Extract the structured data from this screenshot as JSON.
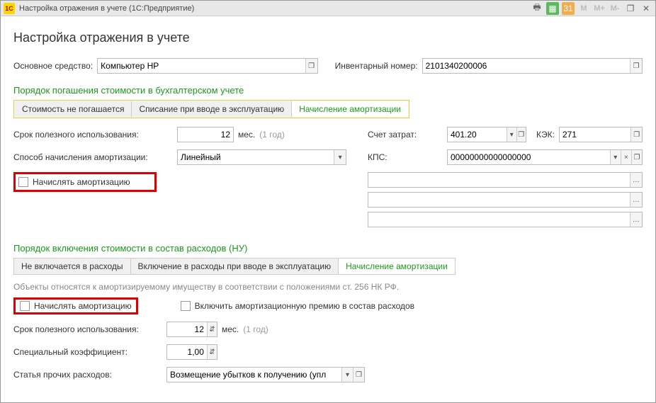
{
  "window": {
    "title": "Настройка отражения в учете  (1С:Предприятие)",
    "m_buttons": [
      "M",
      "M+",
      "M-"
    ]
  },
  "header": "Настройка отражения в учете",
  "top": {
    "asset_label": "Основное средство:",
    "asset_value": "Компьютер HP",
    "inv_label": "Инвентарный номер:",
    "inv_value": "2101340200006"
  },
  "section1": {
    "title": "Порядок погашения стоимости в бухгалтерском учете",
    "tabs": [
      "Стоимость не погашается",
      "Списание при вводе в эксплуатацию",
      "Начисление амортизации"
    ],
    "useful_life_label": "Срок полезного использования:",
    "useful_life_value": "12",
    "useful_life_unit": "мес.",
    "useful_life_hint": "(1 год)",
    "method_label": "Способ начисления амортизации:",
    "method_value": "Линейный",
    "charge_label": "Начислять амортизацию",
    "account_label": "Счет затрат:",
    "account_value": "401.20",
    "kek_label": "КЭК:",
    "kek_value": "271",
    "kps_label": "КПС:",
    "kps_value": "00000000000000000"
  },
  "section2": {
    "title": "Порядок включения стоимости в состав расходов (НУ)",
    "tabs": [
      "Не включается в расходы",
      "Включение в расходы при вводе в эксплуатацию",
      "Начисление амортизации"
    ],
    "note": "Объекты относятся к амортизируемому имуществу в соответствии с положениями ст. 256 НК РФ.",
    "charge_label": "Начислять амортизацию",
    "bonus_label": "Включить амортизационную премию в состав расходов",
    "useful_life_label": "Срок полезного использования:",
    "useful_life_value": "12",
    "useful_life_unit": "мес.",
    "useful_life_hint": "(1 год)",
    "coef_label": "Специальный коэффициент:",
    "coef_value": "1,00",
    "expense_label": "Статья прочих расходов:",
    "expense_value": "Возмещение убытков к получению (упл"
  }
}
